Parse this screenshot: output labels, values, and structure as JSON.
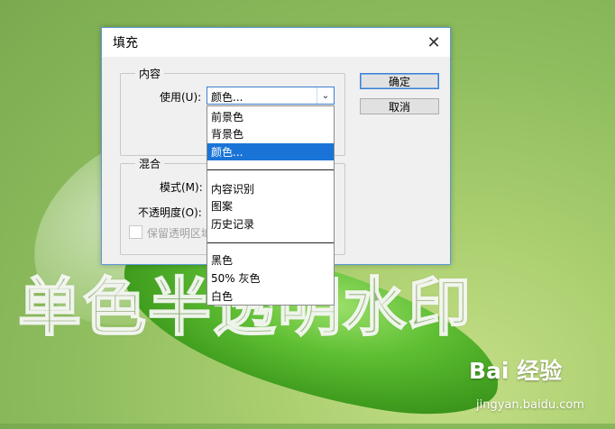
{
  "dialog": {
    "title": "填充",
    "close_glyph": "✕",
    "content_group": {
      "label": "内容",
      "use_label": "使用(U):",
      "use_value": "颜色..."
    },
    "blend_group": {
      "label": "混合",
      "mode_label": "模式(M):",
      "opacity_label": "不透明度(O):",
      "preserve_label": "保留透明区域"
    },
    "buttons": {
      "ok": "确定",
      "cancel": "取消"
    }
  },
  "dropdown": {
    "items": [
      {
        "label": "前景色",
        "selected": false
      },
      {
        "label": "背景色",
        "selected": false
      },
      {
        "label": "颜色...",
        "selected": true
      },
      {
        "label": "内容识别",
        "selected": false
      },
      {
        "label": "图案",
        "selected": false
      },
      {
        "label": "历史记录",
        "selected": false
      },
      {
        "label": "黑色",
        "selected": false
      },
      {
        "label": "50% 灰色",
        "selected": false
      },
      {
        "label": "白色",
        "selected": false
      }
    ]
  },
  "background": {
    "watermark_text": "单色半透明水印",
    "logo_text": "Bai 经验",
    "logo_url": "jingyan.baidu.com"
  },
  "colors": {
    "accent": "#1a74d8",
    "dialog_border": "#5a9ad8"
  }
}
